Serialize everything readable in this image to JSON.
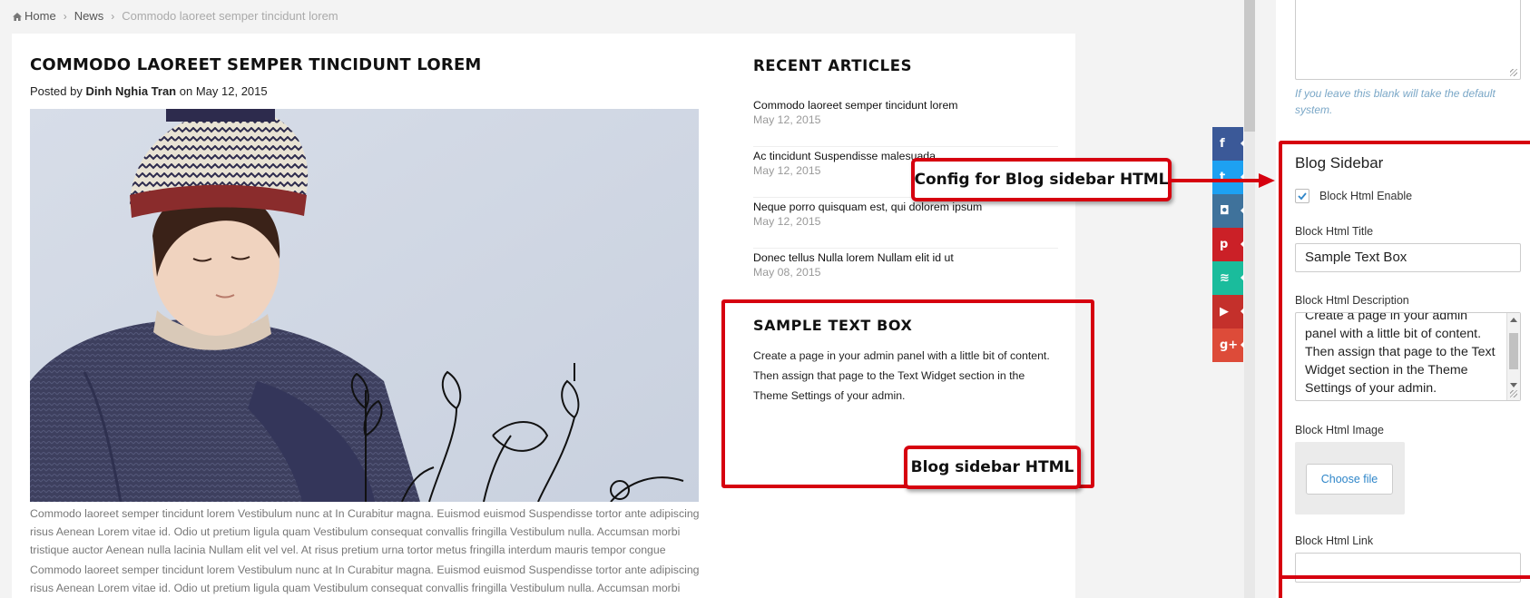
{
  "breadcrumb": {
    "home": "Home",
    "news": "News",
    "current": "Commodo laoreet semper tincidunt lorem",
    "home_icon": "home-icon"
  },
  "post": {
    "title": "COMMODO LAOREET SEMPER TINCIDUNT LOREM",
    "meta_prefix": "Posted by",
    "author": "Dinh Nghia Tran",
    "meta_on": "on",
    "date": "May 12, 2015",
    "body": [
      "Commodo laoreet semper tincidunt lorem Vestibulum nunc at In Curabitur magna. Euismod euismod Suspendisse tortor ante adipiscing risus Aenean Lorem vitae id. Odio ut pretium ligula quam Vestibulum consequat convallis fringilla Vestibulum nulla. Accumsan morbi tristique auctor Aenean nulla lacinia Nullam elit vel vel. At risus pretium urna tortor metus fringilla interdum mauris tempor congue",
      "Commodo laoreet semper tincidunt lorem Vestibulum nunc at In Curabitur magna. Euismod euismod Suspendisse tortor ante adipiscing risus Aenean Lorem vitae id. Odio ut pretium ligula quam Vestibulum consequat convallis fringilla Vestibulum nulla. Accumsan morbi"
    ]
  },
  "recent": {
    "title": "RECENT ARTICLES",
    "items": [
      {
        "title": "Commodo laoreet semper tincidunt lorem",
        "date": "May 12, 2015"
      },
      {
        "title": "Ac tincidunt Suspendisse malesuada",
        "date": "May 12, 2015"
      },
      {
        "title": "Neque porro quisquam est, qui dolorem ipsum",
        "date": "May 12, 2015"
      },
      {
        "title": "Donec tellus Nulla lorem Nullam elit id ut",
        "date": "May 08, 2015"
      }
    ]
  },
  "textbox": {
    "title": "SAMPLE TEXT BOX",
    "body": "Create a page in your admin panel with a little bit of content. Then assign that page to the Text Widget section in the Theme Settings of your admin."
  },
  "callouts": {
    "config": "Config for Blog sidebar HTML",
    "sidebar": "Blog sidebar HTML"
  },
  "social": [
    {
      "icon": "facebook-icon",
      "glyph": "f",
      "color": "#3b5998"
    },
    {
      "icon": "twitter-icon",
      "glyph": "t",
      "color": "#1da1f2"
    },
    {
      "icon": "instagram-icon",
      "glyph": "◘",
      "color": "#3f729b"
    },
    {
      "icon": "pinterest-icon",
      "glyph": "p",
      "color": "#cb2027"
    },
    {
      "icon": "rss-icon",
      "glyph": "≋",
      "color": "#1abc9c"
    },
    {
      "icon": "youtube-icon",
      "glyph": "▶",
      "color": "#c4302b"
    },
    {
      "icon": "google-plus-icon",
      "glyph": "g+",
      "color": "#dd4b39"
    }
  ],
  "admin": {
    "hint": "If you leave this blank will take the default system.",
    "section_title": "Blog Sidebar",
    "enable_label": "Block Html Enable",
    "enable_checked": "true",
    "title_label": "Block Html Title",
    "title_value": "Sample Text Box",
    "description_label": "Block Html Description",
    "description_value": "Create a page in your admin panel with a little bit of content. Then assign that page to the Text Widget section in the Theme Settings of your admin.",
    "image_label": "Block Html Image",
    "choose_file": "Choose file",
    "link_label": "Block Html Link"
  },
  "colors": {
    "accent_red": "#d6000f",
    "link_blue": "#2f86c9",
    "hint_blue": "#7aa7c7"
  }
}
